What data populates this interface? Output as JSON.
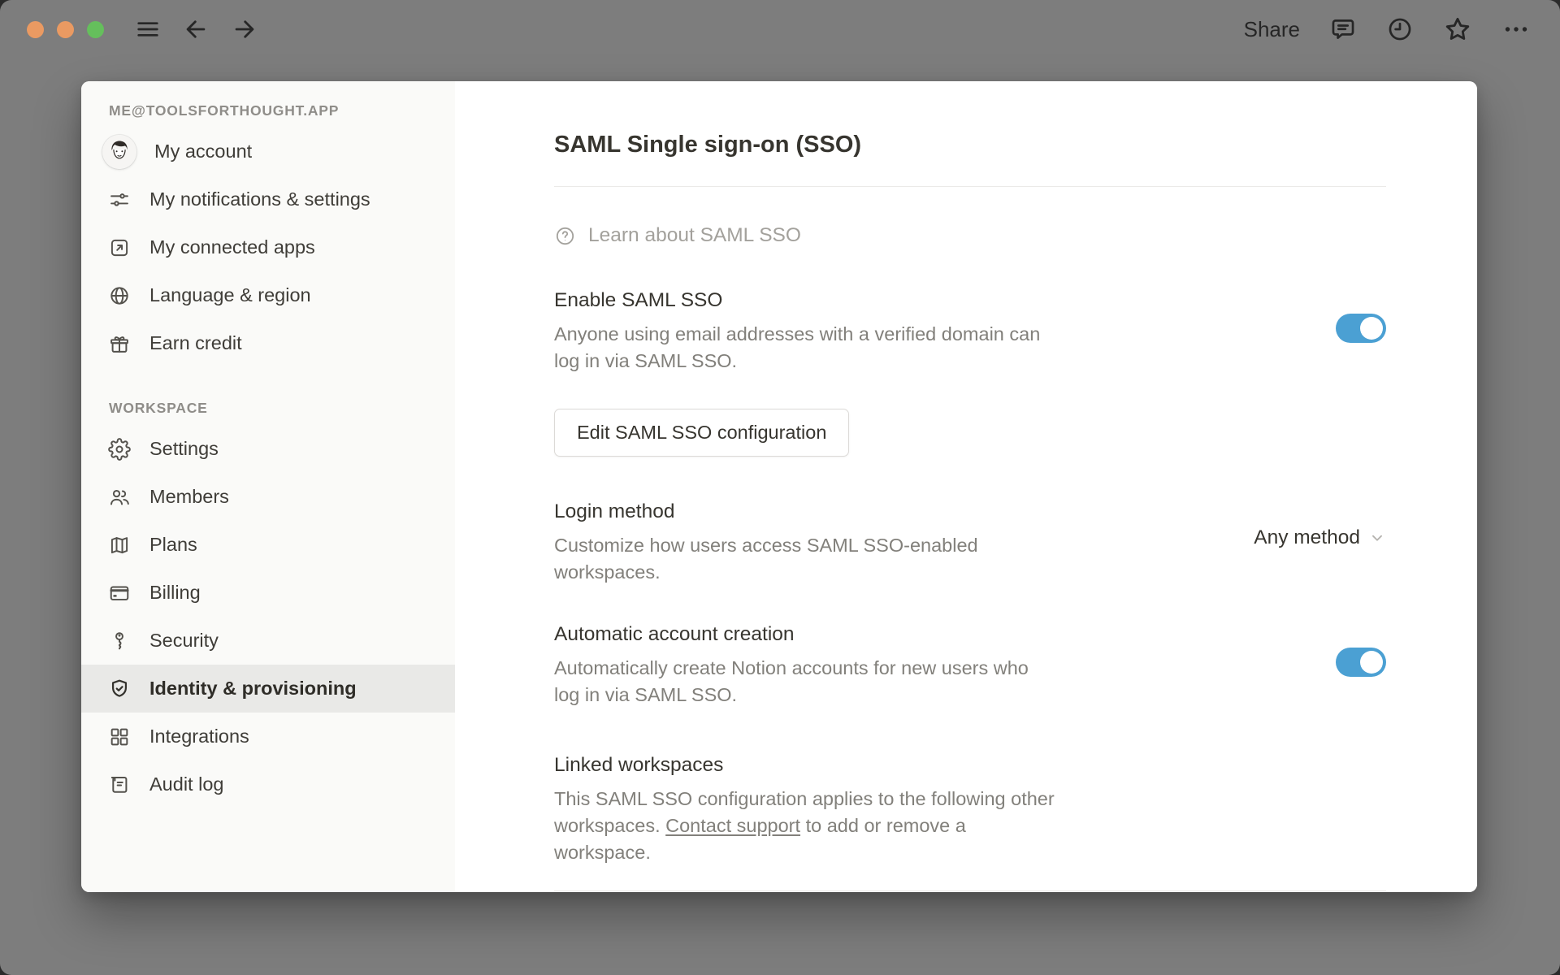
{
  "topbar": {
    "share_label": "Share"
  },
  "sidebar": {
    "account_header": "ME@TOOLSFORTHOUGHT.APP",
    "account_items": [
      {
        "label": "My account",
        "icon": "avatar"
      },
      {
        "label": "My notifications & settings",
        "icon": "sliders-icon"
      },
      {
        "label": "My connected apps",
        "icon": "external-link-icon"
      },
      {
        "label": "Language & region",
        "icon": "globe-icon"
      },
      {
        "label": "Earn credit",
        "icon": "gift-icon"
      }
    ],
    "workspace_header": "WORKSPACE",
    "workspace_items": [
      {
        "label": "Settings",
        "icon": "gear-icon",
        "active": false
      },
      {
        "label": "Members",
        "icon": "members-icon",
        "active": false
      },
      {
        "label": "Plans",
        "icon": "map-icon",
        "active": false
      },
      {
        "label": "Billing",
        "icon": "credit-card-icon",
        "active": false
      },
      {
        "label": "Security",
        "icon": "key-icon",
        "active": false
      },
      {
        "label": "Identity & provisioning",
        "icon": "shield-check-icon",
        "active": true
      },
      {
        "label": "Integrations",
        "icon": "grid-icon",
        "active": false
      },
      {
        "label": "Audit log",
        "icon": "scroll-icon",
        "active": false
      }
    ]
  },
  "main": {
    "title": "SAML Single sign-on (SSO)",
    "learn_link": "Learn about SAML SSO",
    "enable_saml": {
      "title": "Enable SAML SSO",
      "description": "Anyone using email addresses with a verified domain can log in via SAML SSO.",
      "toggle_on": true
    },
    "edit_button_label": "Edit SAML SSO configuration",
    "login_method": {
      "title": "Login method",
      "description": "Customize how users access SAML SSO-enabled workspaces.",
      "selected_value": "Any method"
    },
    "auto_account": {
      "title": "Automatic account creation",
      "description": "Automatically create Notion accounts for new users who log in via SAML SSO.",
      "toggle_on": true
    },
    "linked_workspaces": {
      "title": "Linked workspaces",
      "description_before": "This SAML SSO configuration applies to the following other workspaces. ",
      "link_text": "Contact support",
      "description_after": " to add or remove a workspace."
    }
  },
  "colors": {
    "toggle_on": "#4ba0d3",
    "backdrop": "#7d7d7d",
    "traffic_orange": "#ea9a62",
    "traffic_green": "#65bf5c",
    "sidebar_active": "#e9e9e7"
  }
}
